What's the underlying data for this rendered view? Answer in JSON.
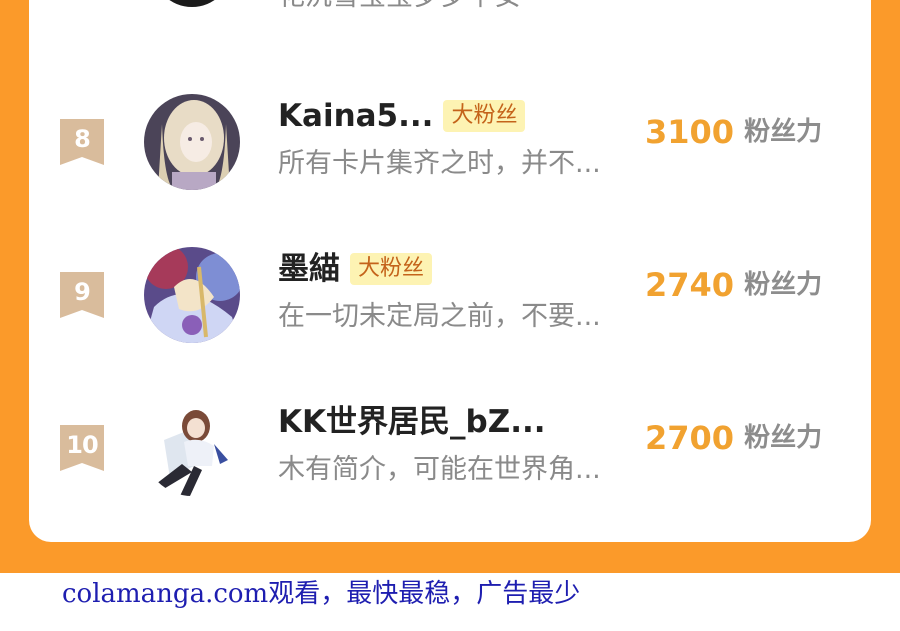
{
  "rows": [
    {
      "rank": "",
      "name": "",
      "tag": "",
      "intro": "花沉雪宝宝岁岁平安",
      "score": "",
      "unit": ""
    },
    {
      "rank": "8",
      "name": "Kaina5...",
      "tag": "大粉丝",
      "intro": "所有卡片集齐之时，并不...",
      "score": "3100",
      "unit": "粉丝力"
    },
    {
      "rank": "9",
      "name": "墨緢",
      "tag": "大粉丝",
      "intro": "在一切未定局之前，不要...",
      "score": "2740",
      "unit": "粉丝力"
    },
    {
      "rank": "10",
      "name": "KK世界居民_bZ...",
      "tag": "",
      "intro": "木有简介，可能在世界角...",
      "score": "2700",
      "unit": "粉丝力"
    }
  ],
  "footer": {
    "text": "colamanga.com观看，最快最稳，广告最少"
  },
  "colors": {
    "background_orange": "#fb9a2a",
    "card": "#ffffff",
    "score": "#f1a230",
    "tag_bg": "#fdf3b3",
    "tag_text": "#c4631a",
    "rank_badge": "#d9bc9c",
    "footer_link": "#1e1eb0"
  }
}
